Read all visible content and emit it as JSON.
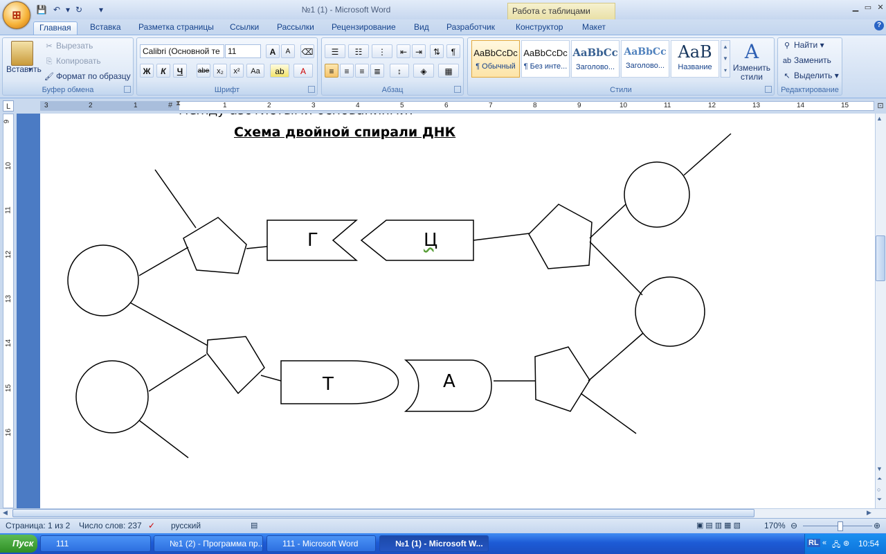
{
  "window": {
    "title": "№1 (1) - Microsoft Word",
    "context_tab_group": "Работа с таблицами"
  },
  "quick_access": [
    "save-icon",
    "undo-icon",
    "redo-icon",
    "customize-icon"
  ],
  "tabs": [
    {
      "label": "Главная",
      "active": true
    },
    {
      "label": "Вставка"
    },
    {
      "label": "Разметка страницы"
    },
    {
      "label": "Ссылки"
    },
    {
      "label": "Рассылки"
    },
    {
      "label": "Рецензирование"
    },
    {
      "label": "Вид"
    },
    {
      "label": "Разработчик"
    },
    {
      "label": "Конструктор"
    },
    {
      "label": "Макет"
    }
  ],
  "clipboard": {
    "label": "Буфер обмена",
    "paste": "Вставить",
    "cut": "Вырезать",
    "copy": "Копировать",
    "format_painter": "Формат по образцу"
  },
  "font": {
    "label": "Шрифт",
    "font_name": "Calibri (Основной те",
    "font_size": "11",
    "bold": "Ж",
    "italic": "К",
    "underline": "Ч",
    "strike": "abe",
    "subscript": "x₂",
    "superscript": "x²",
    "change_case": "Aa",
    "grow": "A",
    "shrink": "A"
  },
  "paragraph": {
    "label": "Абзац"
  },
  "styles": {
    "label": "Стили",
    "items": [
      {
        "sample": "AaBbCcDc",
        "name": "¶ Обычный"
      },
      {
        "sample": "AaBbCcDc",
        "name": "¶ Без инте..."
      },
      {
        "sample": "AaBbCc",
        "name": "Заголово..."
      },
      {
        "sample": "AaBbCc",
        "name": "Заголово..."
      },
      {
        "sample": "AaB",
        "name": "Название"
      }
    ],
    "change_styles": "Изменить стили"
  },
  "editing": {
    "label": "Редактирование",
    "find": "Найти",
    "replace": "Заменить",
    "select": "Выделить"
  },
  "ruler": {
    "h_numbers": [
      "3",
      "2",
      "1",
      "1",
      "2",
      "3",
      "4",
      "5",
      "6",
      "7",
      "8",
      "9",
      "10",
      "11",
      "12",
      "13",
      "14",
      "15"
    ],
    "v_numbers": [
      "9",
      "10",
      "11",
      "12",
      "13",
      "14",
      "15",
      "16"
    ]
  },
  "document": {
    "prev_line": "между азотистыми основаниями?",
    "heading": "Схема двойной спирали ДНК",
    "bases": {
      "g": "Г",
      "c": "Ц",
      "t": "Т",
      "a": "А"
    }
  },
  "status": {
    "page": "Страница: 1 из 2",
    "words": "Число слов: 237",
    "language": "русский",
    "zoom": "170%"
  },
  "taskbar": {
    "start": "Пуск",
    "tasks": [
      {
        "label": "111"
      },
      {
        "label": "№1 (2) - Программа пр..."
      },
      {
        "label": "111 - Microsoft Word"
      },
      {
        "label": "№1 (1) - Microsoft W...",
        "active": true
      }
    ],
    "lang": "RL",
    "time": "10:54"
  }
}
